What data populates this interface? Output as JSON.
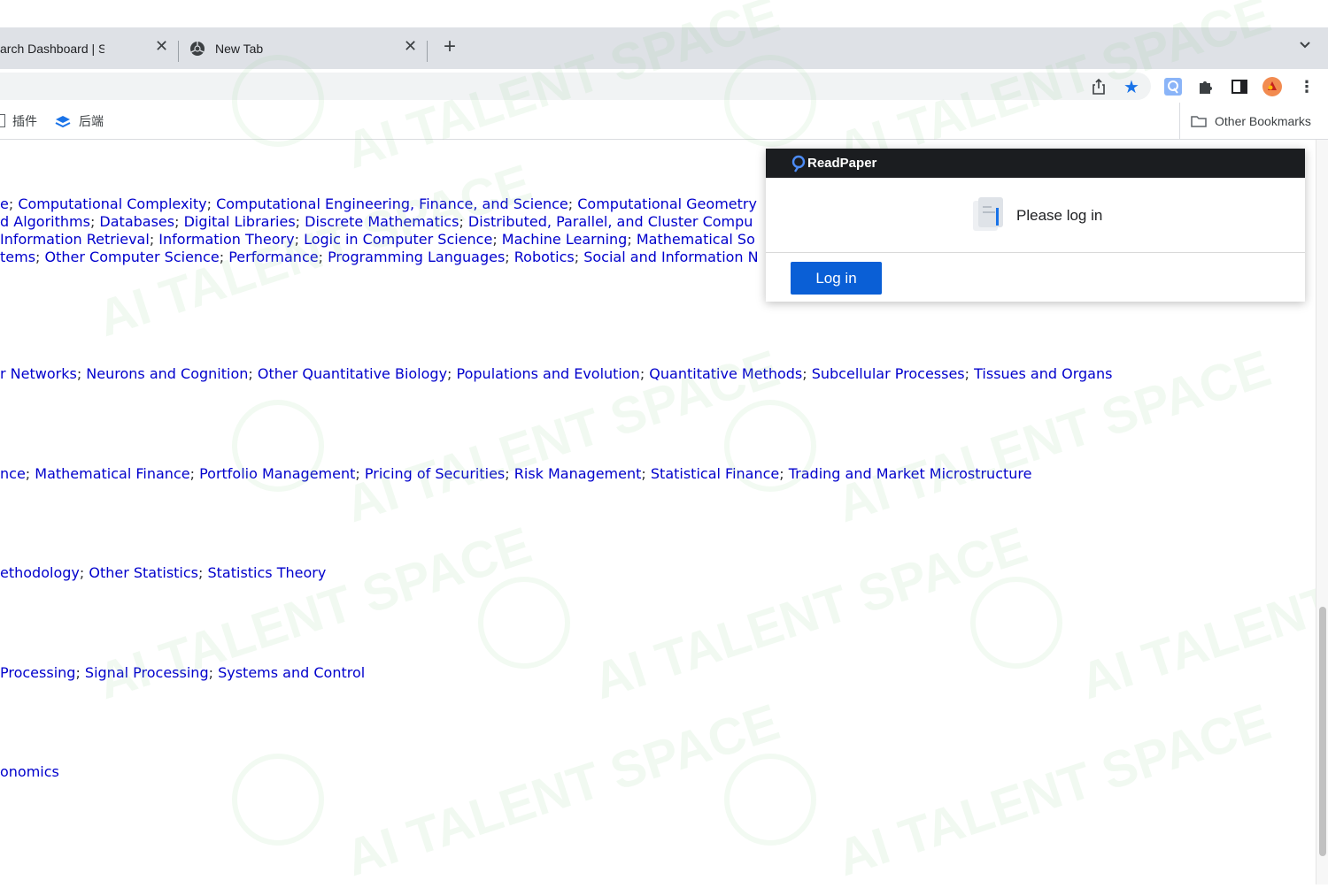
{
  "tabs": [
    {
      "title": "arch Dashboard | S",
      "active": true
    },
    {
      "title": "New Tab",
      "active": false
    }
  ],
  "bookmarks": {
    "items": [
      {
        "label": "插件"
      },
      {
        "label": "后端"
      }
    ],
    "other": "Other Bookmarks"
  },
  "content": {
    "lines": [
      {
        "text": "e; Computational Complexity; Computational Engineering, Finance, and Science; Computational Geometry"
      },
      {
        "text": "d Algorithms; Databases; Digital Libraries; Discrete Mathematics; Distributed, Parallel, and Cluster Compu"
      },
      {
        "text": "Information Retrieval; Information Theory; Logic in Computer Science; Machine Learning; Mathematical So"
      },
      {
        "text": "tems; Other Computer Science; Performance; Programming Languages; Robotics; Social and Information N"
      },
      {
        "text": "r Networks; Neurons and Cognition; Other Quantitative Biology; Populations and Evolution; Quantitative Methods; Subcellular Processes; Tissues and Organs"
      },
      {
        "text": "nce; Mathematical Finance; Portfolio Management; Pricing of Securities; Risk Management; Statistical Finance; Trading and Market Microstructure"
      },
      {
        "text": "ethodology; Other Statistics; Statistics Theory"
      },
      {
        "text": "Processing; Signal Processing; Systems and Control"
      },
      {
        "text": "onomics"
      }
    ]
  },
  "popup": {
    "brand": "ReadPaper",
    "message": "Please log in",
    "login_label": "Log in"
  },
  "watermark": "AI TALENT SPACE",
  "colors": {
    "link": "#0000cc",
    "login_button": "#0a5fd6",
    "popup_header": "#1b1d20",
    "star": "#1a73e8"
  }
}
